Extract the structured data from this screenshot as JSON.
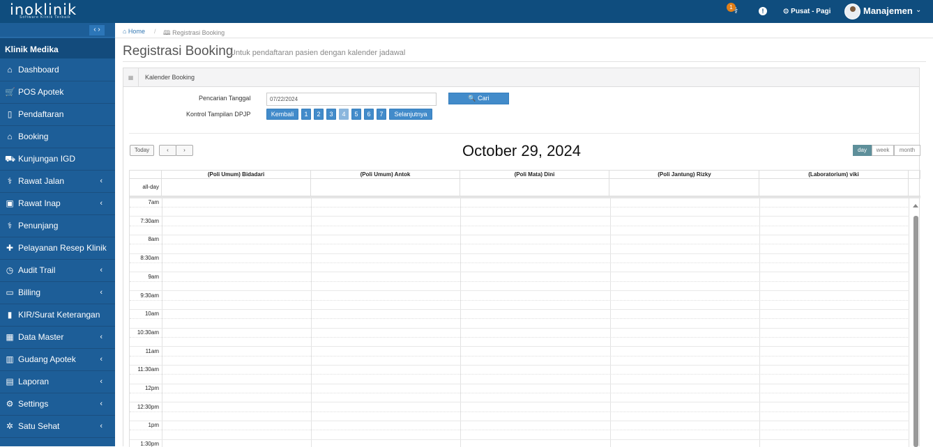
{
  "header": {
    "logo": "inoklinik",
    "logo_sub": "Software Klinik Terbaik",
    "notif_count": "1",
    "alert": "!",
    "branch": "⊙ Pusat - Pagi",
    "user": "Manajemen"
  },
  "sidebar": {
    "toggle": "‹ ›",
    "clinic": "Klinik Medika",
    "items": [
      {
        "label": "Dashboard",
        "icon": "home-icon",
        "glyph": "⌂",
        "sub": false
      },
      {
        "label": "POS Apotek",
        "icon": "cart-icon",
        "glyph": "🛒",
        "sub": false
      },
      {
        "label": "Pendaftaran",
        "icon": "clipboard-icon",
        "glyph": "▯",
        "sub": false
      },
      {
        "label": "Booking",
        "icon": "home-filled-icon",
        "glyph": "⌂",
        "sub": false
      },
      {
        "label": "Kunjungan IGD",
        "icon": "ambulance-icon",
        "glyph": "⛟",
        "sub": false
      },
      {
        "label": "Rawat Jalan",
        "icon": "stethoscope-icon",
        "glyph": "⚕",
        "sub": true
      },
      {
        "label": "Rawat Inap",
        "icon": "hospital-icon",
        "glyph": "▣",
        "sub": true
      },
      {
        "label": "Penunjang",
        "icon": "stethoscope-icon",
        "glyph": "⚕",
        "sub": false
      },
      {
        "label": "Pelayanan Resep Klinik",
        "icon": "medkit-icon",
        "glyph": "✚",
        "sub": false
      },
      {
        "label": "Audit Trail",
        "icon": "clock-icon",
        "glyph": "◷",
        "sub": true
      },
      {
        "label": "Billing",
        "icon": "card-icon",
        "glyph": "▭",
        "sub": true
      },
      {
        "label": "KIR/Surat Keterangan",
        "icon": "file-icon",
        "glyph": "▮",
        "sub": false
      },
      {
        "label": "Data Master",
        "icon": "grid-icon",
        "glyph": "▦",
        "sub": true
      },
      {
        "label": "Gudang Apotek",
        "icon": "barcode-icon",
        "glyph": "▥",
        "sub": true
      },
      {
        "label": "Laporan",
        "icon": "report-icon",
        "glyph": "▤",
        "sub": true
      },
      {
        "label": "Settings",
        "icon": "gear-icon",
        "glyph": "⚙",
        "sub": true
      },
      {
        "label": "Satu Sehat",
        "icon": "atom-icon",
        "glyph": "✲",
        "sub": true
      }
    ],
    "chevron": "‹"
  },
  "breadcrumb": {
    "home": "⌂ Home",
    "sep": "/",
    "current": "🕮 Registrasi Booking"
  },
  "page": {
    "title": "Registrasi Booking",
    "subtitle": "Untuk pendaftaran pasien dengan kalender jadawal"
  },
  "panel": {
    "icon": "▦",
    "title": "Kalender Booking",
    "search_label": "Pencarian Tanggal",
    "date_value": "07/22/2024",
    "search_button": "🔍 Cari",
    "dpjp_label": "Kontrol Tampilan DPJP",
    "pages": [
      "Kembali",
      "1",
      "2",
      "3",
      "4",
      "5",
      "6",
      "7",
      "Selanjutnya"
    ],
    "active_page": "4"
  },
  "calendar": {
    "today": "Today",
    "prev": "‹",
    "next": "›",
    "title": "October 29, 2024",
    "views": [
      "day",
      "week",
      "month"
    ],
    "active_view": "day",
    "columns": [
      "(Poli Umum) Bidadari",
      "(Poli Umum) Antok",
      "(Poli Mata) Dini",
      "(Poli Jantung) Rizky",
      "(Laboratorium) viki"
    ],
    "allday_label": "all-day",
    "times": [
      "7am",
      "7:30am",
      "8am",
      "8:30am",
      "9am",
      "9:30am",
      "10am",
      "10:30am",
      "11am",
      "11:30am",
      "12pm",
      "12:30pm",
      "1pm",
      "1:30pm"
    ]
  }
}
